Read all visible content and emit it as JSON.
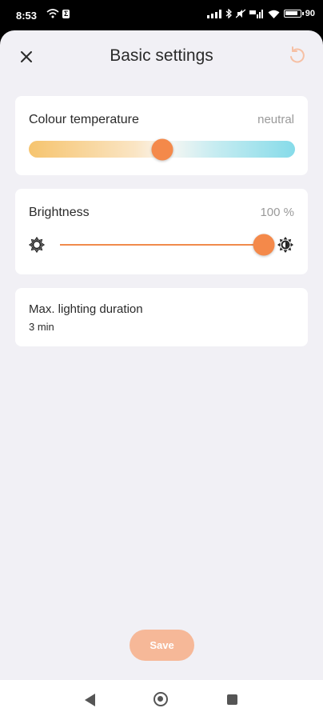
{
  "status_bar": {
    "time": "8:53",
    "battery": "90"
  },
  "header": {
    "title": "Basic settings",
    "close_icon": "close-icon",
    "reset_icon": "reset-icon"
  },
  "colour_temperature": {
    "label": "Colour temperature",
    "value": "neutral",
    "level": 0.5
  },
  "brightness": {
    "label": "Brightness",
    "value": "100 %",
    "level": 1.0
  },
  "lighting_duration": {
    "label": "Max. lighting duration",
    "value": "3 min"
  },
  "save": {
    "label": "Save"
  },
  "colors": {
    "accent": "#f4894a",
    "save_disabled": "#f6b898"
  }
}
